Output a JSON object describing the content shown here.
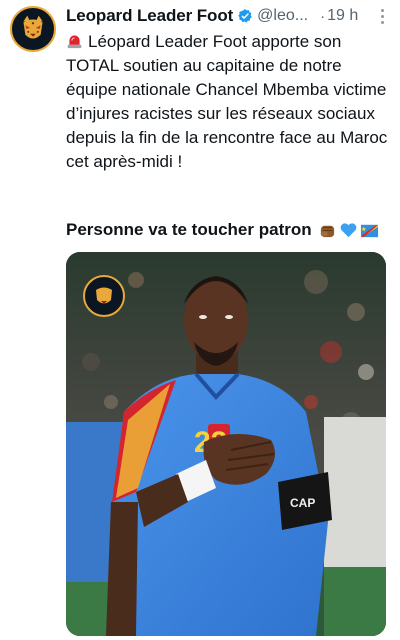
{
  "tweet": {
    "display_name": "Leopard Leader Foot",
    "handle": "@leo...",
    "separator": "·",
    "time": "19 h",
    "body": "Léopard Leader Foot apporte son TOTAL soutien au capitaine de notre équipe nationale Chancel Mbemba victime d’injures racistes sur les réseaux sociaux depuis la fin de la rencontre face au Maroc cet après-midi !",
    "tagline": "Personne va te toucher patron",
    "icons": {
      "avatar": "leopard-logo",
      "verified": "verified-badge-icon",
      "more": "more-options-icon",
      "siren": "siren-emoji",
      "tagline_emojis": [
        "fist-emoji",
        "blue-heart-emoji",
        "drc-flag-emoji"
      ]
    },
    "media": {
      "jersey_number": "22",
      "armband_text": "CAP"
    }
  },
  "colors": {
    "text": "#0f1419",
    "secondary": "#536471",
    "verified": "#1d9bf0",
    "jersey_blue": "#3d86e0",
    "jersey_red": "#d4242e"
  }
}
